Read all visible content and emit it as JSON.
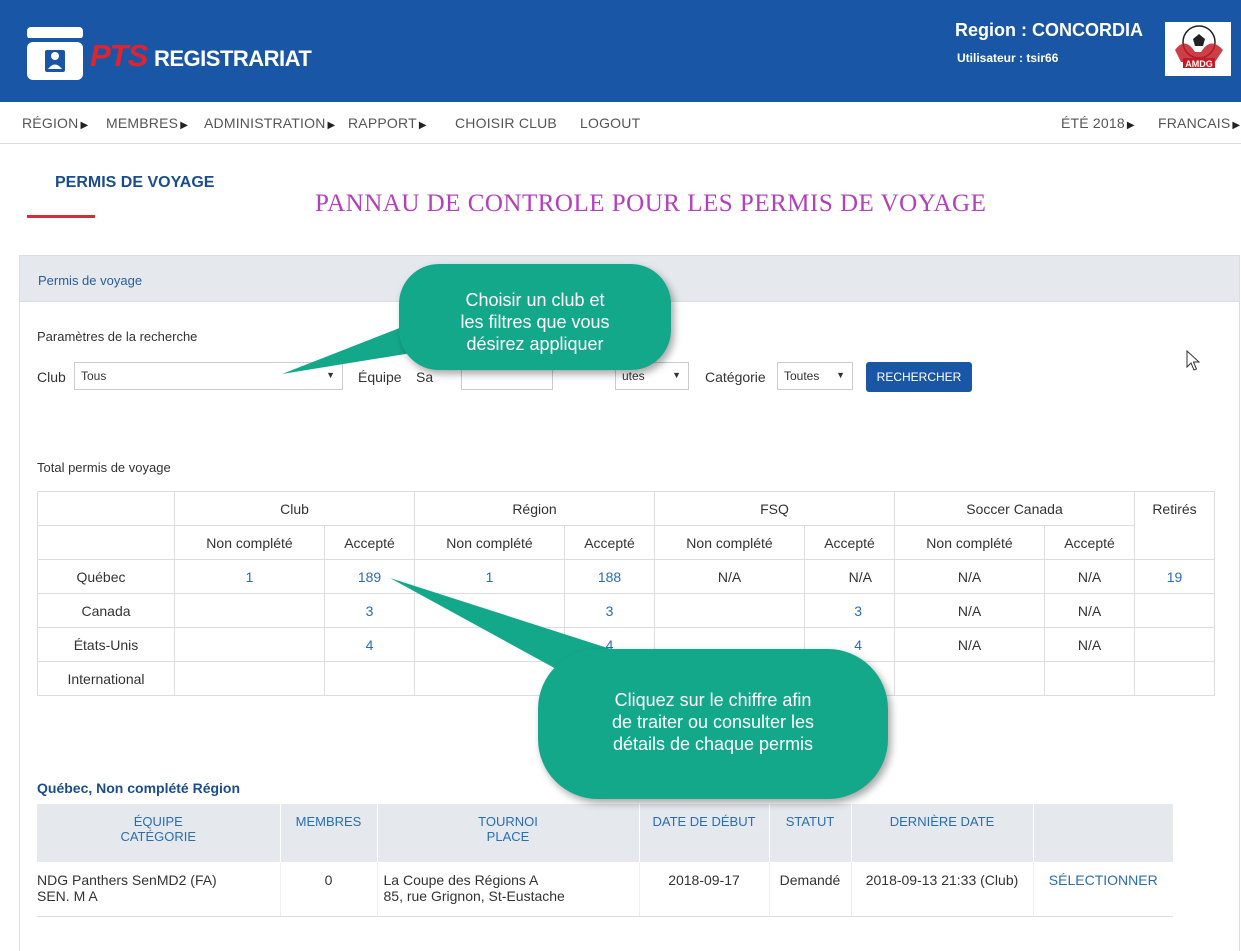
{
  "header": {
    "logo_pts": "PTS",
    "logo_registrariat": "REGISTRARIAT",
    "region": "Region : CONCORDIA",
    "user": "Utilisateur : tsir66"
  },
  "nav": {
    "items": [
      {
        "label": "RÉGION",
        "caret": "▶"
      },
      {
        "label": "MEMBRES",
        "caret": "▶"
      },
      {
        "label": "ADMINISTRATION",
        "caret": "▶"
      },
      {
        "label": "RAPPORT",
        "caret": "▶"
      },
      {
        "label": "CHOISIR CLUB"
      },
      {
        "label": "LOGOUT"
      }
    ],
    "season": "ÉTÉ 2018",
    "language": "FRANCAIS",
    "caret": "▶"
  },
  "page": {
    "title": "PERMIS DE VOYAGE",
    "banner": "PANNAU DE CONTROLE POUR LES PERMIS DE VOYAGE"
  },
  "panel": {
    "heading": "Permis de voyage",
    "search_params": "Paramètres de la recherche",
    "filters": {
      "club_label": "Club",
      "club_value": "Tous",
      "equipe_label": "Équipe",
      "equipe_partial": "Sa",
      "partial_select": "utes",
      "categorie_label": "Catégorie",
      "categorie_value": "Toutes",
      "search_button": "RECHERCHER"
    }
  },
  "summary": {
    "title": "Total permis de voyage",
    "groups": [
      "Club",
      "Région",
      "FSQ",
      "Soccer Canada",
      "Retirés"
    ],
    "subheaders": [
      "Non complété",
      "Accepté"
    ],
    "rows": [
      {
        "label": "Québec",
        "cells": [
          "1",
          "189",
          "1",
          "188",
          "N/A",
          "N/A",
          "N/A",
          "N/A",
          "19"
        ]
      },
      {
        "label": "Canada",
        "cells": [
          "",
          "3",
          "",
          "3",
          "",
          "3",
          "N/A",
          "N/A",
          ""
        ]
      },
      {
        "label": "États-Unis",
        "cells": [
          "",
          "4",
          "",
          "4",
          "",
          "4",
          "N/A",
          "N/A",
          ""
        ]
      },
      {
        "label": "International",
        "cells": [
          "",
          "",
          "",
          "",
          "",
          "",
          "",
          "",
          ""
        ]
      }
    ]
  },
  "detail": {
    "title": "Québec, Non complété Région",
    "headers": {
      "equipe": "ÉQUIPE",
      "categorie": "CATÉGORIE",
      "membres": "MEMBRES",
      "tournoi": "TOURNOI",
      "place": "PLACE",
      "date_debut": "DATE DE DÉBUT",
      "statut": "STATUT",
      "derniere_date": "DERNIÈRE DATE"
    },
    "row": {
      "equipe": "NDG Panthers SenMD2 (FA)",
      "categorie": "SEN. M A",
      "membres": "0",
      "tournoi": "La Coupe des Régions A",
      "place": "85, rue Grignon, St-Eustache",
      "date_debut": "2018-09-17",
      "statut": "Demandé",
      "derniere_date": "2018-09-13 21:33 (Club)",
      "action": "SÉLECTIONNER"
    }
  },
  "callouts": {
    "top": [
      "Choisir un club et",
      "les filtres que vous",
      "désirez appliquer"
    ],
    "bottom": [
      "Cliquez sur le chiffre afin",
      "de traiter ou consulter les",
      "détails de chaque permis"
    ]
  },
  "colors": {
    "header_blue": "#1a56a6",
    "accent_red": "#d62c3b",
    "link_blue": "#2a6db5",
    "callout_green": "#14a88a",
    "banner_magenta": "#b53dbf"
  }
}
